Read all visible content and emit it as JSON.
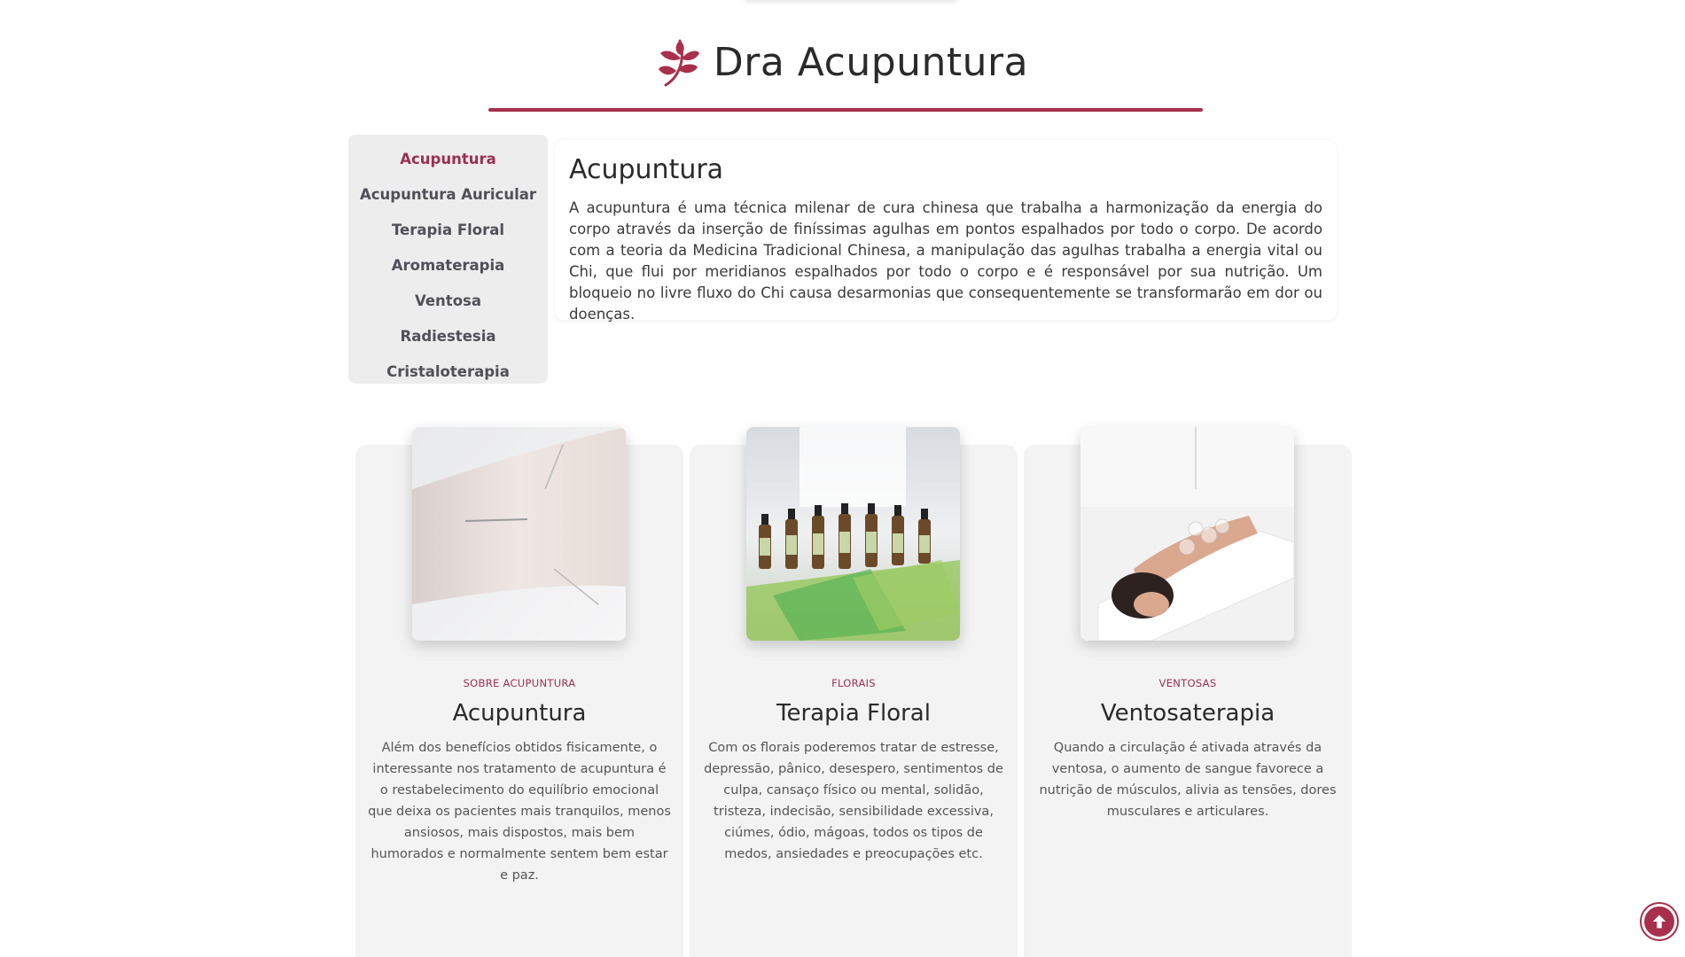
{
  "brand": {
    "name": "Dra Acupuntura",
    "accent": "#a8304c",
    "logo_icon": "leaf-branch-icon"
  },
  "sidebar": {
    "items": [
      {
        "label": "Acupuntura",
        "active": true
      },
      {
        "label": "Acupuntura Auricular",
        "active": false
      },
      {
        "label": "Terapia Floral",
        "active": false
      },
      {
        "label": "Aromaterapia",
        "active": false
      },
      {
        "label": "Ventosa",
        "active": false
      },
      {
        "label": "Radiestesia",
        "active": false
      },
      {
        "label": "Cristaloterapia",
        "active": false
      }
    ]
  },
  "content": {
    "title": "Acupuntura",
    "text": "A acupuntura é uma técnica milenar de cura chinesa que trabalha a harmonização da energia do corpo através da inserção de finíssimas agulhas em pontos espalhados por todo o corpo. De acordo com a teoria da Medicina Tradicional Chinesa, a manipulação das agulhas trabalha a energia vital ou Chi, que flui por meridianos espalhados por todo o corpo e é responsável por sua nutrição. Um bloqueio no livre fluxo do Chi causa desarmonias que consequentemente se transformarão em dor ou doenças."
  },
  "cards": [
    {
      "eyebrow": "SOBRE ACUPUNTURA",
      "title": "Acupuntura",
      "text": "Além dos benefícios obtidos fisicamente, o interessante nos tratamento de acupuntura é o restabelecimento do equilíbrio emocional que deixa os pacientes mais tranquilos, menos ansiosos, mais dispostos, mais bem humorados e normalmente sentem bem estar e paz."
    },
    {
      "eyebrow": "FLORAIS",
      "title": "Terapia Floral",
      "text": "Com os florais poderemos tratar de estresse, depressão, pânico, desespero, sentimentos de culpa, cansaço físico ou mental, solidão, tristeza, indecisão, sensibilidade excessiva, ciúmes, ódio, mágoas, todos os tipos de medos, ansiedades e preocupações etc."
    },
    {
      "eyebrow": "VENTOSAS",
      "title": "Ventosaterapia",
      "text": "Quando a circulação é ativada através da ventosa, o aumento de sangue favorece a nutrição de músculos, alivia as tensões, dores musculares e articulares."
    }
  ],
  "back_to_top": {
    "icon": "arrow-up-icon"
  }
}
